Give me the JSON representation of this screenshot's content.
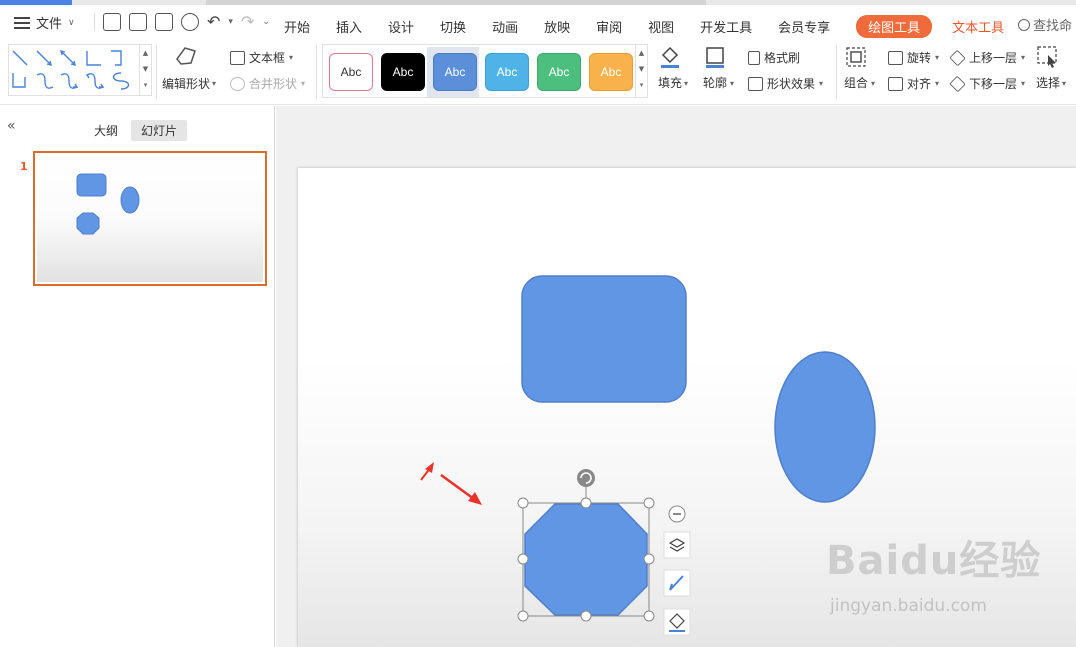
{
  "menubar": {
    "file_label": "文件",
    "tabs": [
      {
        "label": "开始"
      },
      {
        "label": "插入"
      },
      {
        "label": "设计"
      },
      {
        "label": "切换"
      },
      {
        "label": "动画"
      },
      {
        "label": "放映"
      },
      {
        "label": "审阅"
      },
      {
        "label": "视图"
      },
      {
        "label": "开发工具"
      },
      {
        "label": "会员专享"
      },
      {
        "label": "绘图工具"
      },
      {
        "label": "文本工具"
      }
    ],
    "search_label": "查找命"
  },
  "ribbon": {
    "edit_shape": "编辑形状",
    "textbox": "文本框",
    "merge_shape": "合并形状",
    "style_buttons": [
      {
        "label": "Abc",
        "bg": "#ffffff",
        "fg": "#333333",
        "border": "#e07a8e"
      },
      {
        "label": "Abc",
        "bg": "#000000",
        "fg": "#ffffff",
        "border": "#000000"
      },
      {
        "label": "Abc",
        "bg": "#5b8fd9",
        "fg": "#ffffff",
        "border": "#4a7bc4"
      },
      {
        "label": "Abc",
        "bg": "#4fb3e8",
        "fg": "#ffffff",
        "border": "#3fa0d4"
      },
      {
        "label": "Abc",
        "bg": "#4cbe7e",
        "fg": "#ffffff",
        "border": "#3da86c"
      },
      {
        "label": "Abc",
        "bg": "#f9b14c",
        "fg": "#ffffff",
        "border": "#e89e36"
      }
    ],
    "fill": "填充",
    "outline": "轮廓",
    "format_painter": "格式刷",
    "shape_effect": "形状效果",
    "group": "组合",
    "rotate": "旋转",
    "align": "对齐",
    "bring_forward": "上移一层",
    "send_backward": "下移一层",
    "select": "选择"
  },
  "left_panel": {
    "tab_outline": "大纲",
    "tab_slides": "幻灯片",
    "slide_number": "1"
  },
  "colors": {
    "shape_fill": "#6196e5",
    "shape_stroke": "#4f7fc9",
    "accent_orange": "#ef6b3b",
    "arrow_red": "#e8322a"
  },
  "watermark": {
    "brand": "Baidu经验",
    "url": "jingyan.baidu.com"
  }
}
